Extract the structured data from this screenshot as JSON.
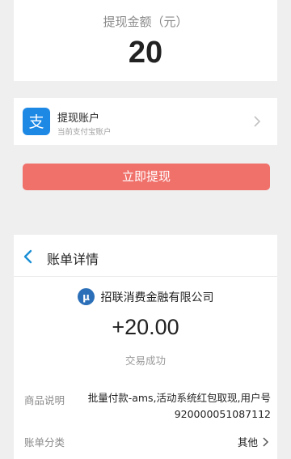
{
  "withdraw": {
    "amount_label": "提现金额（元）",
    "amount_value": "20",
    "account_title": "提现账户",
    "account_subtitle": "当前支付宝账户",
    "account_icon": "alipay-icon",
    "button_label": "立即提现",
    "button_color": "#f0706a"
  },
  "bill": {
    "title": "账单详情",
    "merchant_name": "招联消费金融有限公司",
    "amount": "+20.00",
    "status": "交易成功",
    "description_label": "商品说明",
    "description_value": "批量付款-ams,活动系统红包取现,用户号920000051087112",
    "category_label": "账单分类",
    "category_value": "其他"
  },
  "colors": {
    "alipay_blue": "#1e88e5",
    "back_arrow": "#1a8fd6"
  }
}
